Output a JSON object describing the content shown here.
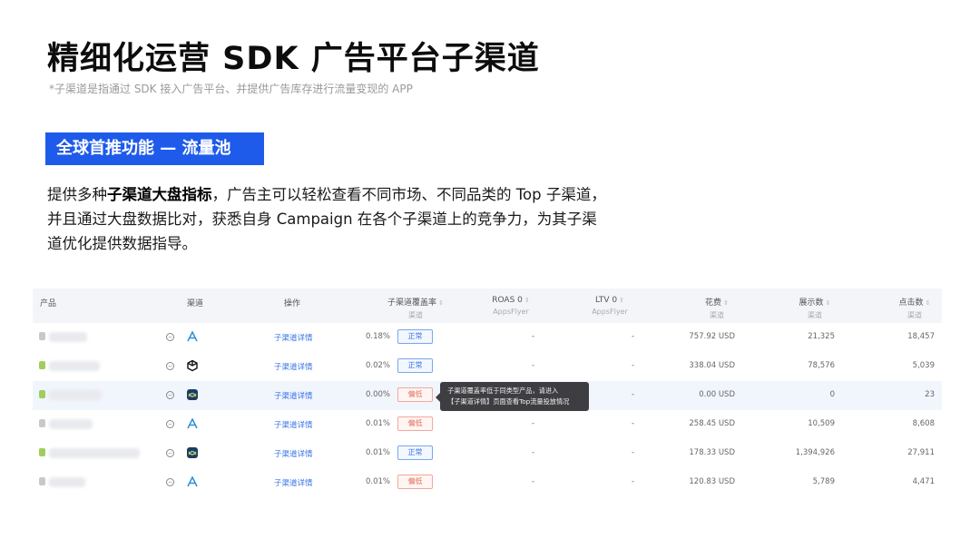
{
  "title": "精细化运营 SDK 广告平台子渠道",
  "subtitle": "*子渠道是指通过 SDK 接入广告平台、并提供广告库存进行流量变现的 APP",
  "badge": "全球首推功能 — 流量池",
  "description": {
    "part1": "提供多种",
    "bold": "子渠道大盘指标",
    "part2": "，广告主可以轻松查看不同市场、不同品类的 Top 子渠道，并且通过大盘数据比对，获悉自身 Campaign 在各个子渠道上的竞争力，为其子渠道优化提供数据指导。"
  },
  "table": {
    "headers": {
      "product": "产品",
      "channel": "渠道",
      "action": "操作",
      "coverage": "子渠道覆盖率",
      "coverage_sub": "渠道",
      "roas": "ROAS 0",
      "roas_sub": "AppsFlyer",
      "ltv": "LTV 0",
      "ltv_sub": "AppsFlyer",
      "spend": "花费",
      "spend_sub": "渠道",
      "impressions": "展示数",
      "impressions_sub": "渠道",
      "clicks": "点击数",
      "clicks_sub": "渠道"
    },
    "rows": [
      {
        "os": "ios",
        "channel_icon": "appier-a-icon",
        "action": "子渠道详情",
        "coverage": "0.18%",
        "status": "正常",
        "status_type": "ok",
        "roas": "-",
        "ltv": "-",
        "spend": "757.92 USD",
        "impressions": "21,325",
        "clicks": "18,457"
      },
      {
        "os": "android",
        "channel_icon": "unity-cube-icon",
        "action": "子渠道详情",
        "coverage": "0.02%",
        "status": "正常",
        "status_type": "ok",
        "roas": "-",
        "ltv": "-",
        "spend": "338.04 USD",
        "impressions": "78,576",
        "clicks": "5,039"
      },
      {
        "os": "android",
        "channel_icon": "mintegral-icon",
        "action": "子渠道详情",
        "coverage": "0.00%",
        "status": "偏低",
        "status_type": "low",
        "roas": "",
        "ltv": "-",
        "spend": "0.00 USD",
        "impressions": "0",
        "clicks": "23"
      },
      {
        "os": "ios",
        "channel_icon": "appier-a-icon",
        "action": "子渠道详情",
        "coverage": "0.01%",
        "status": "偏低",
        "status_type": "low",
        "roas": "-",
        "ltv": "-",
        "spend": "258.45 USD",
        "impressions": "10,509",
        "clicks": "8,608"
      },
      {
        "os": "android",
        "channel_icon": "mintegral-icon",
        "action": "子渠道详情",
        "coverage": "0.01%",
        "status": "正常",
        "status_type": "ok",
        "roas": "-",
        "ltv": "-",
        "spend": "178.33 USD",
        "impressions": "1,394,926",
        "clicks": "27,911"
      },
      {
        "os": "ios",
        "channel_icon": "appier-a-icon",
        "action": "子渠道详情",
        "coverage": "0.01%",
        "status": "偏低",
        "status_type": "low",
        "roas": "-",
        "ltv": "-",
        "spend": "120.83 USD",
        "impressions": "5,789",
        "clicks": "4,471"
      }
    ]
  },
  "tooltip": {
    "line1": "子渠道覆盖率低于同类型产品，请进入",
    "line2": "【子渠道详情】页面查看Top流量投放情况"
  },
  "colors": {
    "accent": "#1f5bea",
    "link": "#3a74e6",
    "ok": "#3a74e6",
    "low": "#e06a55",
    "header_bg": "#f4f5f8",
    "highlight_row": "#f1f5fc",
    "tooltip_bg": "#3e3e42"
  }
}
